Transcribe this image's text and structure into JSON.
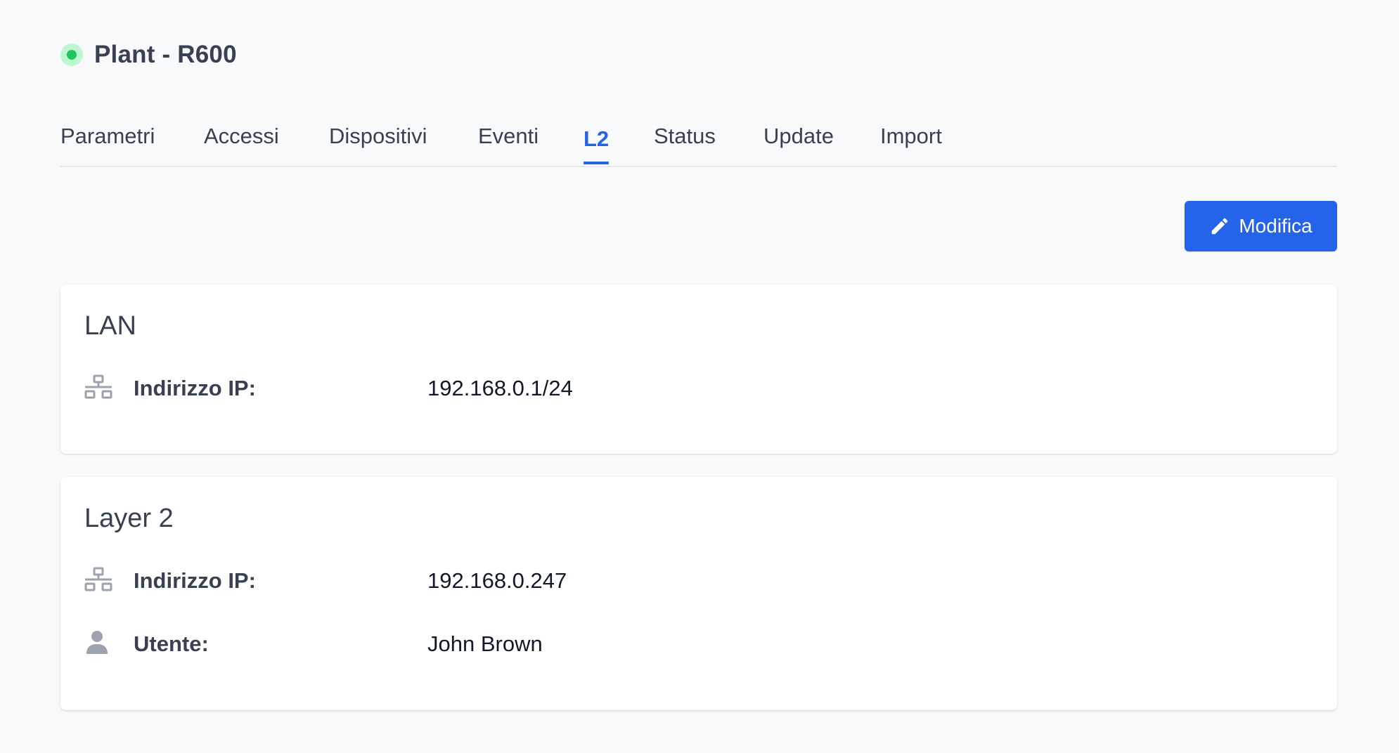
{
  "header": {
    "title": "Plant - R600",
    "status_color": "#22c55e"
  },
  "tabs": [
    {
      "label": "Parametri",
      "active": false
    },
    {
      "label": "Accessi",
      "active": false
    },
    {
      "label": "Dispositivi",
      "active": false
    },
    {
      "label": "Eventi",
      "active": false
    },
    {
      "label": "L2",
      "active": true
    },
    {
      "label": "Status",
      "active": false
    },
    {
      "label": "Update",
      "active": false
    },
    {
      "label": "Import",
      "active": false
    }
  ],
  "toolbar": {
    "edit_label": "Modifica",
    "edit_icon": "pencil-icon"
  },
  "cards": {
    "lan": {
      "title": "LAN",
      "rows": [
        {
          "icon": "network-icon",
          "label": "Indirizzo IP:",
          "value": "192.168.0.1/24"
        }
      ]
    },
    "layer2": {
      "title": "Layer 2",
      "rows": [
        {
          "icon": "network-icon",
          "label": "Indirizzo IP:",
          "value": "192.168.0.247"
        },
        {
          "icon": "user-icon",
          "label": "Utente:",
          "value": "John Brown"
        }
      ]
    }
  },
  "colors": {
    "accent": "#2563eb",
    "background": "#f8f9fb",
    "status_online": "#22c55e"
  }
}
